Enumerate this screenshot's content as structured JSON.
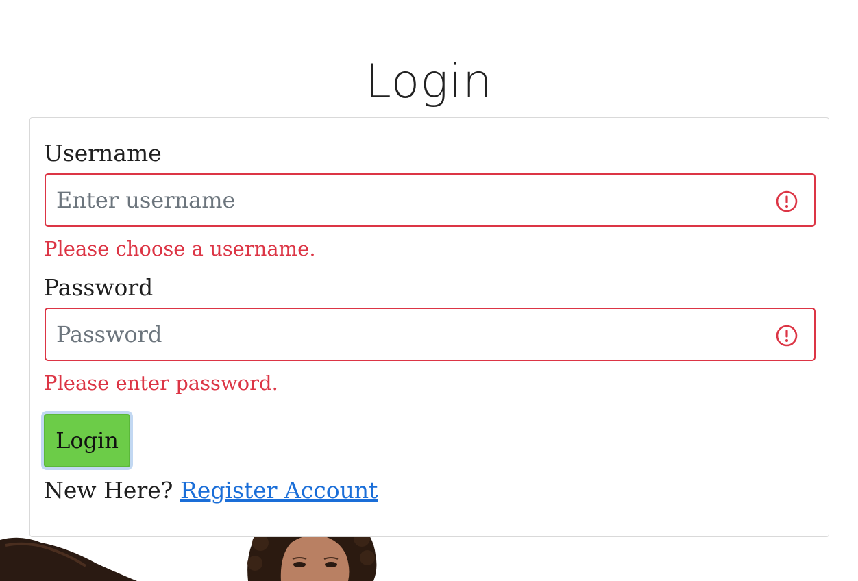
{
  "page": {
    "title": "Login"
  },
  "form": {
    "username": {
      "label": "Username",
      "placeholder": "Enter username",
      "value": "",
      "error": "Please choose a username."
    },
    "password": {
      "label": "Password",
      "placeholder": "Password",
      "value": "",
      "error": "Please enter password."
    },
    "submit_label": "Login",
    "register_prompt": "New Here?",
    "register_link_label": "Register Account"
  },
  "colors": {
    "error": "#dc3545",
    "button": "#6ccc48",
    "link": "#1a6ed8",
    "focus_ring": "#c2d8f2"
  },
  "icons": {
    "field_error": "alert-circle-icon"
  }
}
